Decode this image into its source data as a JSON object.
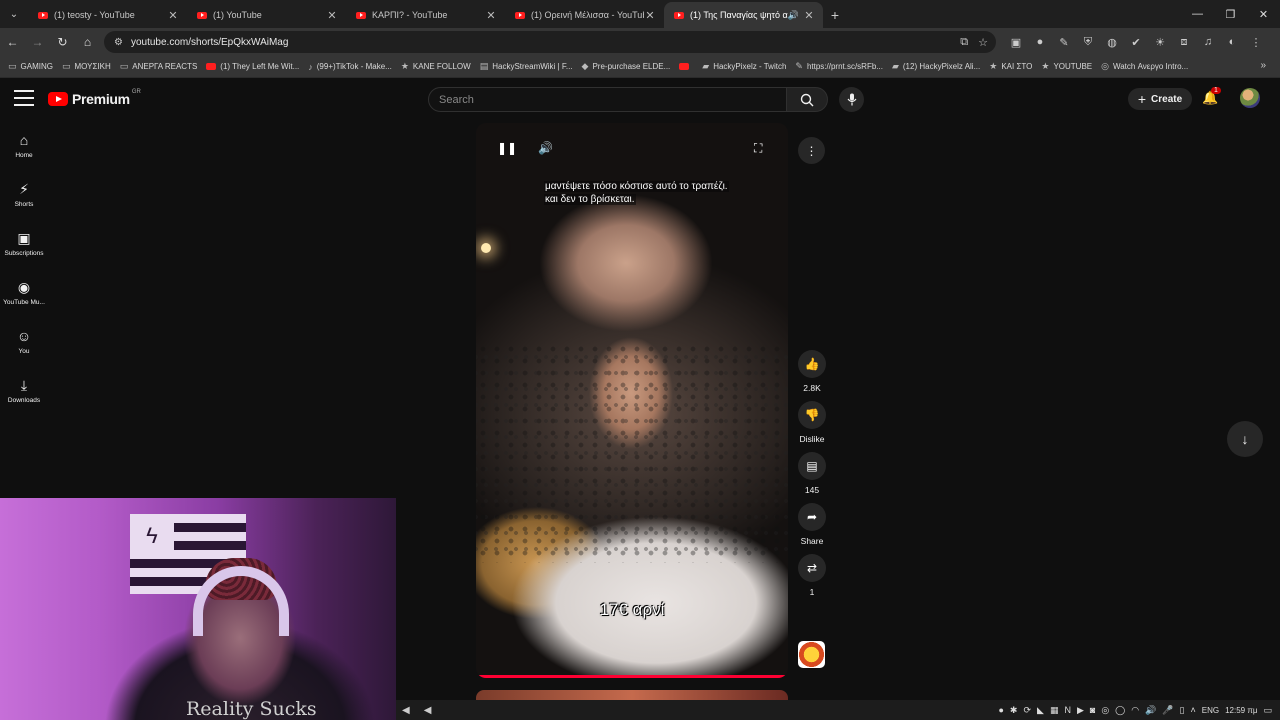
{
  "browser": {
    "tabs": [
      {
        "title": "(1) teosty - YouTube",
        "active": false
      },
      {
        "title": "(1) YouTube",
        "active": false
      },
      {
        "title": "ΚΑΡΠΙ? - YouTube",
        "active": false
      },
      {
        "title": "(1) Ορεινή Μέλισσα - YouTube",
        "active": false
      },
      {
        "title": "(1) Της Παναγίας ψητό αρ",
        "active": true
      }
    ],
    "url": "youtube.com/shorts/EpQkxWAiMag",
    "bookmarks": [
      {
        "label": "GAMING",
        "icon": "folder-icon"
      },
      {
        "label": "ΜΟΥΣΙΚΗ",
        "icon": "folder-icon"
      },
      {
        "label": "ΑΝΕΡΓΑ REACTS",
        "icon": "folder-icon"
      },
      {
        "label": "(1) They Left Me Wit...",
        "icon": "youtube-icon"
      },
      {
        "label": "(99+)TikTok - Make...",
        "icon": "tiktok-icon"
      },
      {
        "label": "KANE FOLLOW",
        "icon": "star-icon"
      },
      {
        "label": "HackyStreamWiki | F...",
        "icon": "page-icon"
      },
      {
        "label": "Pre-purchase ELDE...",
        "icon": "steam-icon"
      },
      {
        "label": "",
        "icon": "youtube-icon"
      },
      {
        "label": "HackyPixelz - Twitch",
        "icon": "twitch-icon"
      },
      {
        "label": "https://prnt.sc/sRFb...",
        "icon": "pen-icon"
      },
      {
        "label": "(12) HackyPixelz Ali...",
        "icon": "twitch-icon"
      },
      {
        "label": "ΚΑΙ ΣΤΟ",
        "icon": "star-icon"
      },
      {
        "label": "YOUTUBE",
        "icon": "star-icon"
      },
      {
        "label": "Watch Ανεργο Intro...",
        "icon": "page-icon"
      }
    ]
  },
  "youtube": {
    "logo": "Premium",
    "country": "GR",
    "search_placeholder": "Search",
    "create_label": "Create",
    "notifications": "1",
    "sidebar": [
      {
        "label": "Home",
        "icon": "home-icon",
        "glyph": "⌂"
      },
      {
        "label": "Shorts",
        "icon": "shorts-icon",
        "glyph": "⚡"
      },
      {
        "label": "Subscriptions",
        "icon": "subscriptions-icon",
        "glyph": "▣"
      },
      {
        "label": "YouTube Mu...",
        "icon": "youtube-music-icon",
        "glyph": "◉"
      },
      {
        "label": "You",
        "icon": "you-icon",
        "glyph": "☺"
      },
      {
        "label": "Downloads",
        "icon": "download-icon",
        "glyph": "⤓"
      }
    ],
    "short": {
      "caption_line1": "μαντέψετε πόσο κόστισε αυτό το τραπέζι.",
      "caption_line2": "και δεν το βρίσκεται.",
      "price_overlay": "17€ αρνί",
      "likes": "2.8K",
      "dislike_label": "Dislike",
      "comments": "145",
      "share_label": "Share",
      "remix_count": "1"
    }
  },
  "webcam": {
    "shirt_text": "Reality Sucks"
  },
  "taskbar": {
    "language": "ENG",
    "time": "12:59 πμ"
  },
  "colors": {
    "accent": "#ff0000",
    "background": "#0f0f0f",
    "progress": "#ff0033"
  }
}
